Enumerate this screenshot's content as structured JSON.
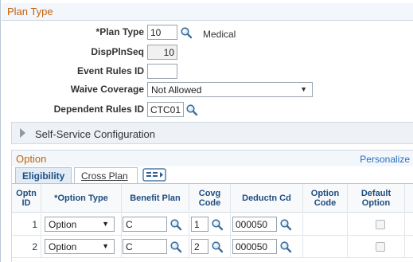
{
  "section": {
    "title": "Plan Type"
  },
  "form": {
    "plan_type_label": "*Plan Type",
    "plan_type_value": "10",
    "plan_type_desc": "Medical",
    "disp_pln_seq_label": "DispPlnSeq",
    "disp_pln_seq_value": "10",
    "event_rules_label": "Event Rules ID",
    "event_rules_value": "",
    "waive_coverage_label": "Waive Coverage",
    "waive_coverage_value": "Not Allowed",
    "dependent_rules_label": "Dependent Rules ID",
    "dependent_rules_value": "CTC01"
  },
  "collapsible": {
    "label": "Self-Service Configuration"
  },
  "grid": {
    "title": "Option",
    "personalize": "Personalize",
    "tabs": [
      {
        "label": "Eligibility",
        "active": true
      },
      {
        "label": "Cross Plan",
        "active": false
      }
    ],
    "headers": [
      "Optn ID",
      "*Option Type",
      "Benefit Plan",
      "Covg Code",
      "Deductn Cd",
      "Option Code",
      "Default Option"
    ],
    "rows": [
      {
        "id": "1",
        "option_type": "Option",
        "benefit_plan": "C",
        "covg_code": "1",
        "deductn_cd": "000050",
        "option_code": "",
        "default_option": false
      },
      {
        "id": "2",
        "option_type": "Option",
        "benefit_plan": "C",
        "covg_code": "2",
        "deductn_cd": "000050",
        "option_code": "",
        "default_option": false
      }
    ]
  },
  "colors": {
    "section_title": "#c4620a",
    "header_text": "#1f4d80",
    "link": "#2a6ebb"
  }
}
